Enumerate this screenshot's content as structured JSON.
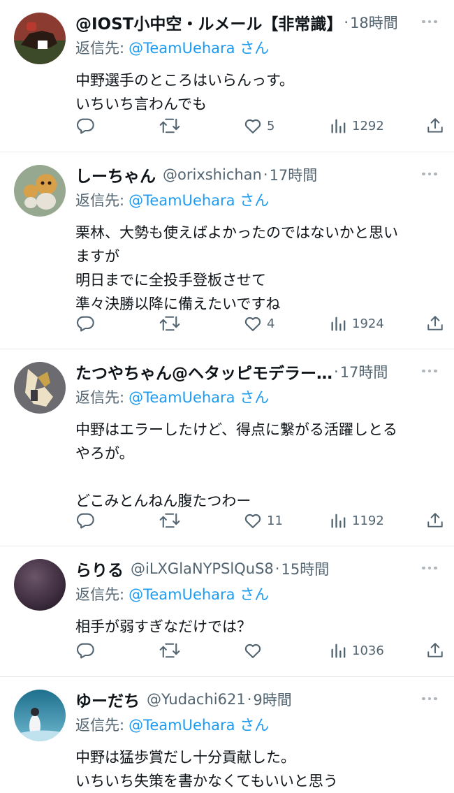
{
  "tweets": [
    {
      "name": "@IOST小中空・ルメール【非常識】",
      "handle": "",
      "time": "18時間",
      "reply_prefix": "返信先:",
      "reply_to": "@TeamUehara さん",
      "lines": [
        "中野選手のところはいらんっす。",
        "いちいち言わんでも"
      ],
      "likes": "5",
      "views": "1292",
      "avatar_colors": [
        "#7a2a2a",
        "#3a4a2a"
      ]
    },
    {
      "name": "しーちゃん",
      "handle": "@orixshichan",
      "time": "17時間",
      "reply_prefix": "返信先:",
      "reply_to": "@TeamUehara さん",
      "lines": [
        "栗林、大勢も使えばよかったのではないかと思い",
        "ますが",
        "明日までに全投手登板させて",
        "準々決勝以降に備えたいですね"
      ],
      "likes": "4",
      "views": "1924",
      "avatar_colors": [
        "#8a9e86",
        "#d9a04a"
      ]
    },
    {
      "name": "たつやちゃん@ヘタッピモデラー…",
      "handle": "",
      "time": "17時間",
      "reply_prefix": "返信先:",
      "reply_to": "@TeamUehara さん",
      "lines": [
        "中野はエラーしたけど、得点に繋がる活躍しとる",
        "やろが。",
        "",
        "どこみとんねん腹たつわー"
      ],
      "likes": "11",
      "views": "1192",
      "avatar_colors": [
        "#5a5a60",
        "#e8d9b8"
      ]
    },
    {
      "name": "らりる",
      "handle": "@iLXGlaNYPSlQuS8",
      "time": "15時間",
      "reply_prefix": "返信先:",
      "reply_to": "@TeamUehara さん",
      "lines": [
        "相手が弱すぎなだけでは？"
      ],
      "likes": "",
      "views": "1036",
      "avatar_colors": [
        "#3b2a3e",
        "#5e4658"
      ]
    },
    {
      "name": "ゆーだち",
      "handle": "@Yudachi621",
      "time": "9時間",
      "reply_prefix": "返信先:",
      "reply_to": "@TeamUehara さん",
      "lines": [
        "中野は猛歩賞だし十分貢献した。",
        "いちいち失策を書かなくてもいいと思う"
      ],
      "likes": "",
      "views": "",
      "avatar_colors": [
        "#1e6e8a",
        "#cfe6f0"
      ]
    }
  ],
  "icons": {
    "reply": "reply-icon",
    "retweet": "retweet-icon",
    "like": "heart-icon",
    "views": "views-icon",
    "share": "share-icon",
    "more": "more-icon"
  },
  "colors": {
    "link": "#1d9bf0",
    "secondary": "#536471",
    "text": "#0f1419",
    "divider": "#e6e9eb"
  }
}
